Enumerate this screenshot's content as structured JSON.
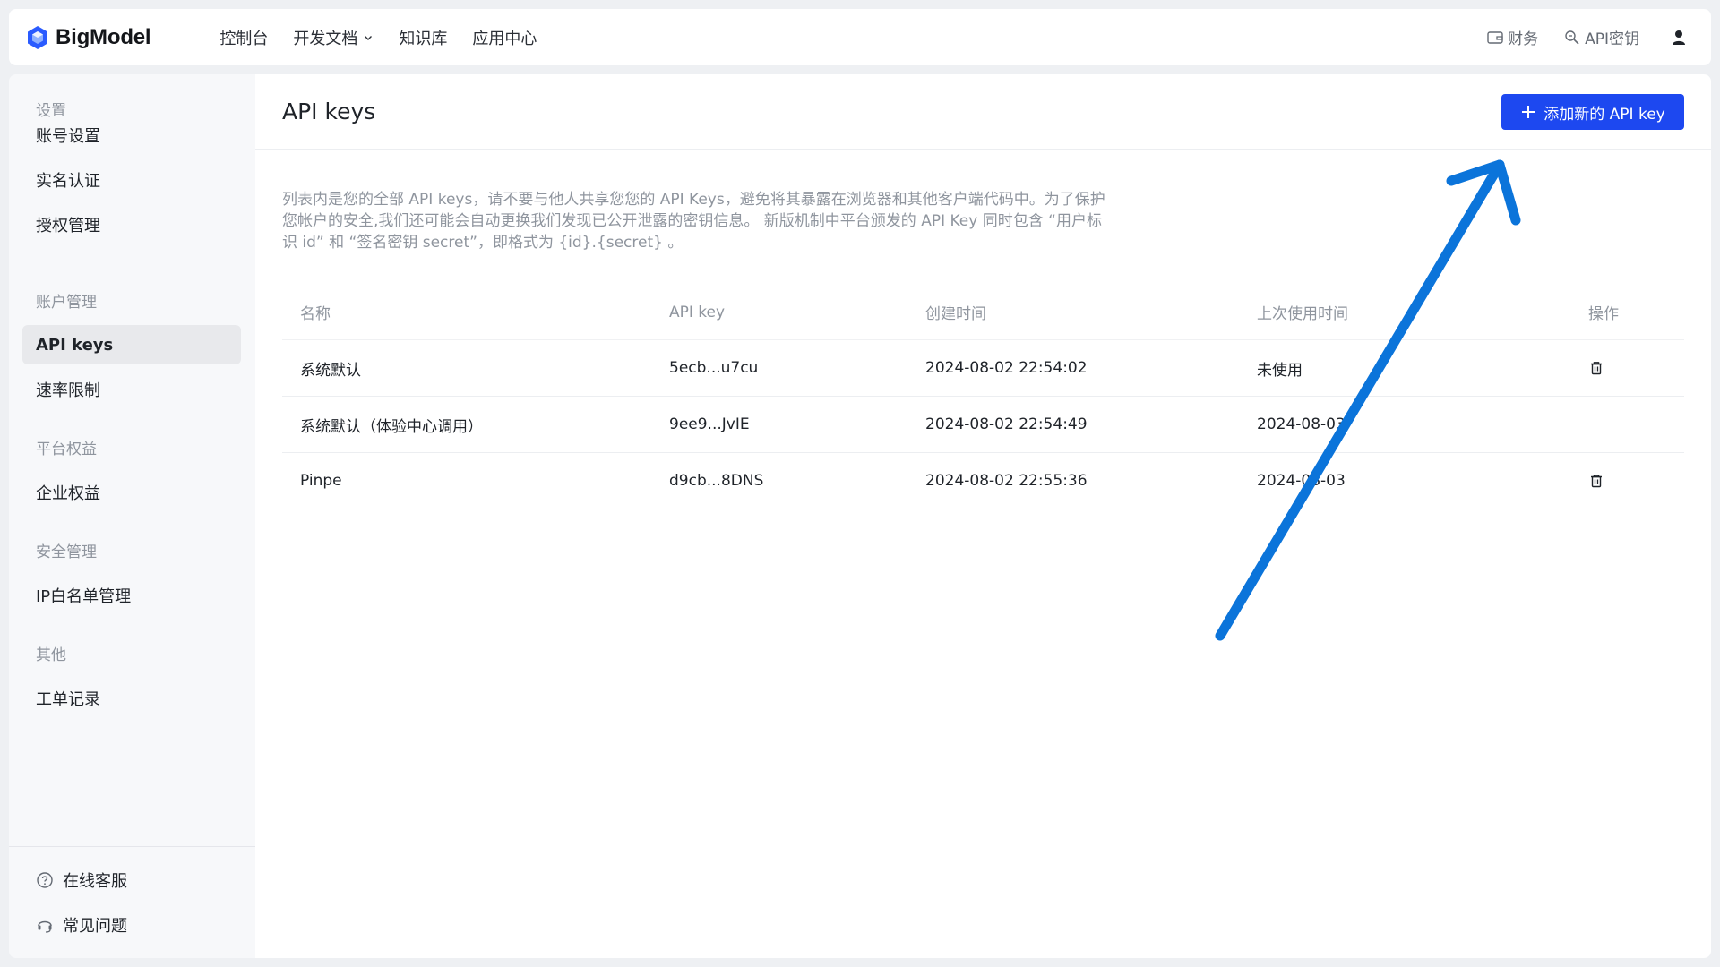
{
  "app": {
    "name": "BigModel",
    "brand_color": "#1d48f0"
  },
  "nav": {
    "items": [
      "控制台",
      "开发文档",
      "知识库",
      "应用中心"
    ]
  },
  "topright": {
    "billing": "财务",
    "apikey": "API密钥"
  },
  "sidebar": {
    "sections": [
      {
        "title": "设置",
        "items": [
          "账号设置",
          "实名认证",
          "授权管理"
        ]
      },
      {
        "title": "账户管理",
        "items": [
          "API keys",
          "速率限制"
        ]
      },
      {
        "title": "平台权益",
        "items": [
          "企业权益"
        ]
      },
      {
        "title": "安全管理",
        "items": [
          "IP白名单管理"
        ]
      },
      {
        "title": "其他",
        "items": [
          "工单记录"
        ]
      }
    ],
    "active": "API keys",
    "bottom": {
      "support": "在线客服",
      "faq": "常见问题"
    }
  },
  "main": {
    "title": "API keys",
    "add_button": "添加新的 API key",
    "description": "列表内是您的全部 API keys，请不要与他人共享您您的 API Keys，避免将其暴露在浏览器和其他客户端代码中。为了保护您帐户的安全,我们还可能会自动更换我们发现已公开泄露的密钥信息。 新版机制中平台颁发的 API Key 同时包含 “用户标识 id” 和 “签名密钥 secret”，即格式为 {id}.{secret} 。",
    "table": {
      "headers": [
        "名称",
        "API key",
        "创建时间",
        "上次使用时间",
        "操作"
      ],
      "rows": [
        {
          "name": "系统默认",
          "key": "5ecb...u7cu",
          "created": "2024-08-02 22:54:02",
          "last_used": "未使用",
          "deletable": true
        },
        {
          "name": "系统默认（体验中心调用）",
          "key": "9ee9...JvIE",
          "created": "2024-08-02 22:54:49",
          "last_used": "2024-08-03",
          "deletable": false
        },
        {
          "name": "Pinpe",
          "key": "d9cb...8DNS",
          "created": "2024-08-02 22:55:36",
          "last_used": "2024-08-03",
          "deletable": true
        }
      ]
    }
  },
  "annotation": {
    "arrow_color": "#0b74da"
  }
}
